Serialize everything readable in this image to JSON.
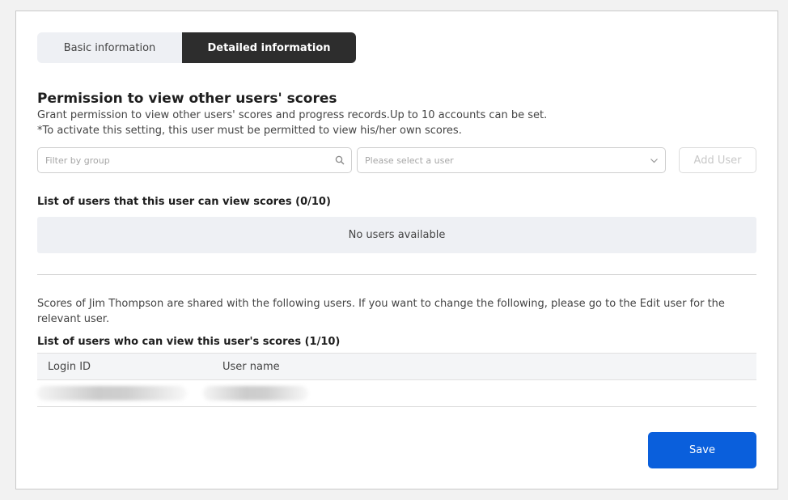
{
  "tabs": [
    {
      "label": "Basic information",
      "active": false
    },
    {
      "label": "Detailed information",
      "active": true
    }
  ],
  "permission": {
    "title": "Permission to view other users' scores",
    "description_1": "Grant permission to view other users' scores and progress records.Up to 10 accounts can be set.",
    "description_2": "*To activate this setting, this user must be permitted to view his/her own scores.",
    "filter_placeholder": "Filter by group",
    "filter_icon": "search-icon",
    "user_select_placeholder": "Please select a user",
    "user_select_icon": "chevron-down-icon",
    "add_user_label": "Add User"
  },
  "viewable_list": {
    "title": "List of users that this user can view scores (0/10)",
    "empty_text": "No users available"
  },
  "shared": {
    "note": "Scores of Jim Thompson are shared with the following users. If you want to change the following, please go to the Edit user for the relevant user.",
    "title": "List of users who can view this user's scores (1/10)",
    "columns": [
      "Login ID",
      "User name"
    ],
    "row_count": 1
  },
  "actions": {
    "save_label": "Save"
  },
  "colors": {
    "active_tab": "#2d2d2d",
    "inactive_tab": "#eef0f4",
    "primary_button": "#0a5fdc"
  }
}
